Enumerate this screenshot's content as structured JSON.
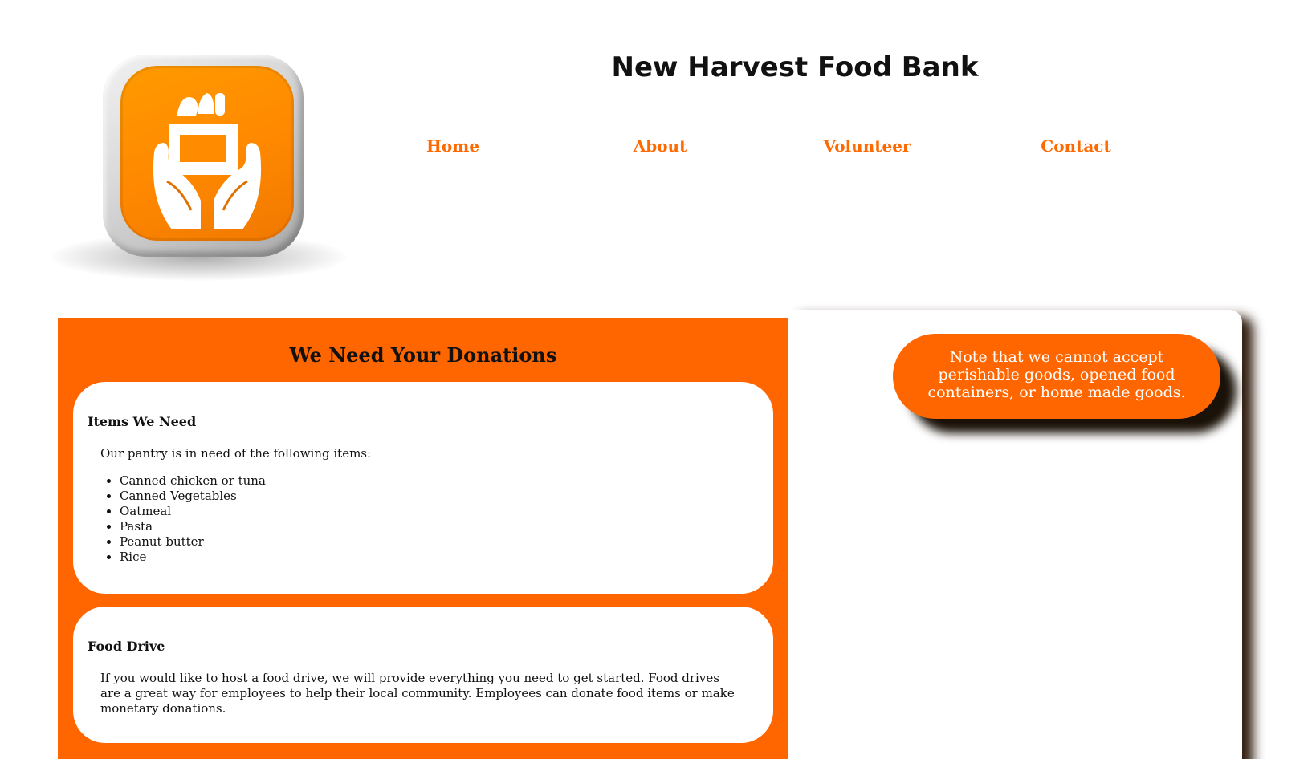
{
  "site": {
    "title": "New Harvest Food Bank",
    "logo_icon": "food-donation-hands-icon",
    "accent_color": "#ff6600"
  },
  "nav": {
    "items": [
      {
        "label": "Home"
      },
      {
        "label": "About"
      },
      {
        "label": "Volunteer"
      },
      {
        "label": "Contact"
      }
    ]
  },
  "main": {
    "heading": "We Need Your Donations",
    "items_card": {
      "title": "Items We Need",
      "intro": "Our pantry is in need of the following items:",
      "items": [
        "Canned chicken or tuna",
        "Canned Vegetables",
        "Oatmeal",
        "Pasta",
        "Peanut butter",
        "Rice"
      ]
    },
    "drive_card": {
      "title": "Food Drive",
      "text": "If you would like to host a food drive, we will provide everything you need to get started. Food drives are a great way for employees to help their local community. Employees can donate food items or make monetary donations."
    }
  },
  "sidebar": {
    "note": "Note that we cannot accept perishable goods, opened food containers, or home made goods."
  }
}
